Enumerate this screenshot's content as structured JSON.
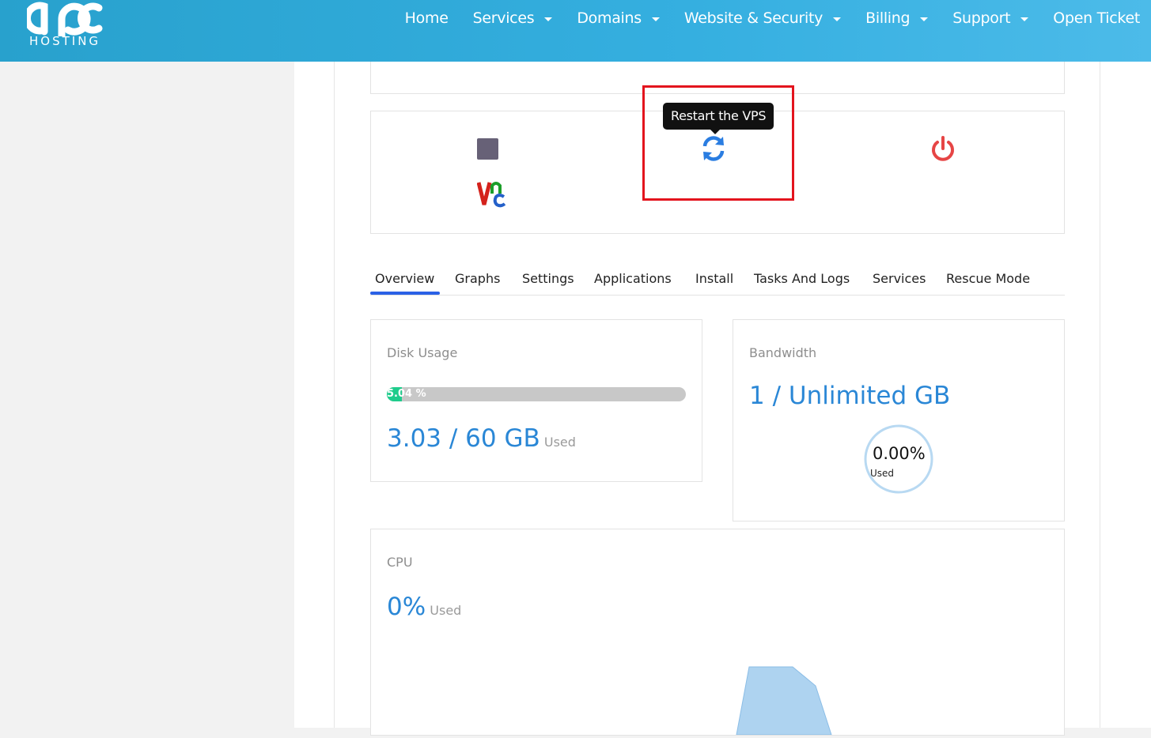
{
  "brand": {
    "logo_text": "apc",
    "logo_sub": "HOSTING"
  },
  "nav": {
    "items": [
      {
        "label": "Home",
        "dropdown": false
      },
      {
        "label": "Services",
        "dropdown": true
      },
      {
        "label": "Domains",
        "dropdown": true
      },
      {
        "label": "Website & Security",
        "dropdown": true
      },
      {
        "label": "Billing",
        "dropdown": true
      },
      {
        "label": "Support",
        "dropdown": true
      },
      {
        "label": "Open Ticket",
        "dropdown": false
      }
    ]
  },
  "actions": {
    "tooltip": "Restart the VPS",
    "icons": [
      "stop-icon",
      "vnc-icon",
      "restart-icon",
      "power-icon"
    ],
    "colors": {
      "stop": "#676177",
      "restart": "#2a7de1",
      "power": "#e64545",
      "highlight": "#e3141d"
    }
  },
  "tabs": [
    {
      "label": "Overview",
      "active": true
    },
    {
      "label": "Graphs"
    },
    {
      "label": "Settings"
    },
    {
      "label": "Applications"
    },
    {
      "label": "Install"
    },
    {
      "label": "Tasks And Logs"
    },
    {
      "label": "Services"
    },
    {
      "label": "Rescue Mode"
    }
  ],
  "disk": {
    "title": "Disk Usage",
    "percent_label": "5.04 %",
    "percent": 5.04,
    "value": "3.03 / 60 GB",
    "used_label": "Used"
  },
  "bandwidth": {
    "title": "Bandwidth",
    "value": "1 / Unlimited GB",
    "donut_percent": "0.00%",
    "donut_used": "Used"
  },
  "cpu": {
    "title": "CPU",
    "value": "0%",
    "used_label": "Used"
  }
}
